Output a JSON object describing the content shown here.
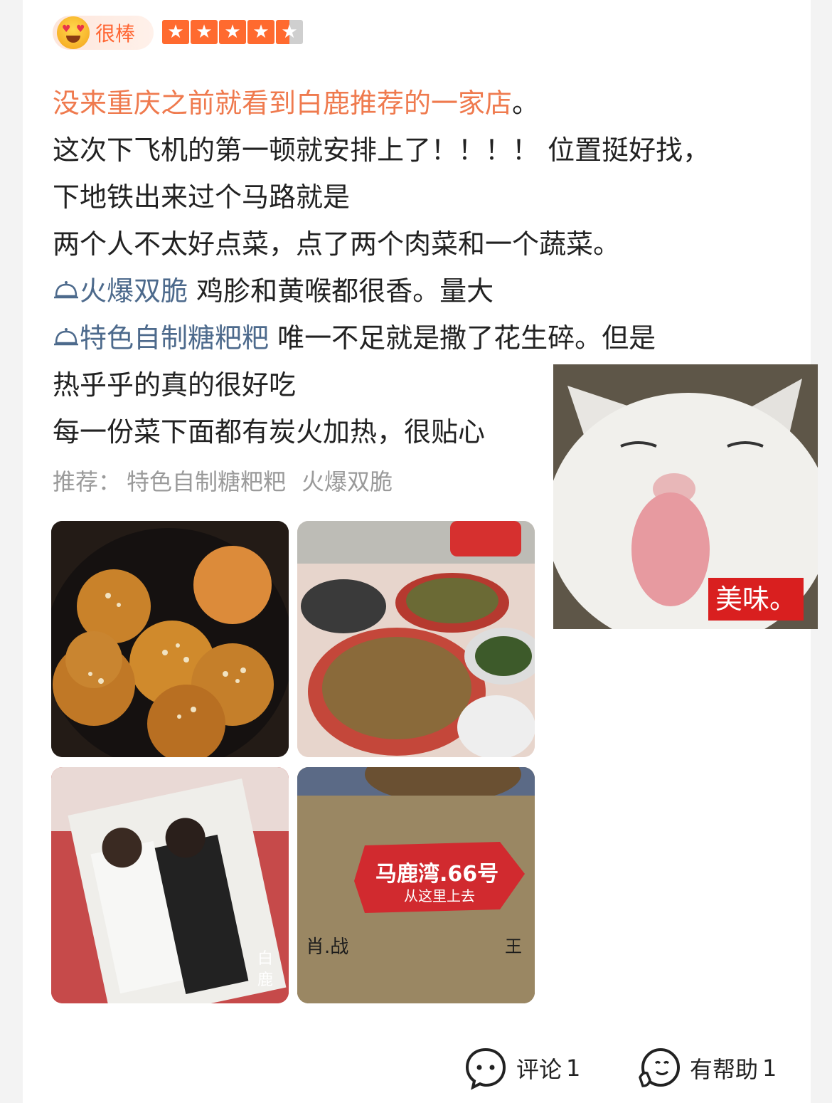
{
  "rating": {
    "badge_label": "很棒",
    "badge_icon": "heart-eyes-emoji-icon",
    "stars": 4.5,
    "star_color": "#ff6a2f"
  },
  "review": {
    "headline": "没来重庆之前就看到白鹿推荐的一家店",
    "headline_end": "。",
    "lines": [
      "这次下飞机的第一顿就安排上了！！！！ 位置挺好找，",
      "下地铁出来过个马路就是",
      "两个人不太好点菜，点了两个肉菜和一个蔬菜。"
    ],
    "dish_mentions": [
      {
        "name": "火爆双脆",
        "comment": " 鸡胗和黄喉都很香。量大"
      },
      {
        "name": "特色自制糖粑粑",
        "comment": " 唯一不足就是撒了花生碎。但是"
      }
    ],
    "closing_lines": [
      "热乎乎的真的很好吃",
      "每一份菜下面都有炭火加热，很贴心"
    ]
  },
  "recommend": {
    "label": "推荐：",
    "dishes": [
      "特色自制糖粑粑",
      "火爆双脆"
    ]
  },
  "photos": {
    "sign_text": "马鹿湾.66号",
    "sign_subtext": "从这里上去",
    "wall_names": [
      "肖.战",
      "王"
    ],
    "photo_card_text": "白鹿"
  },
  "meme": {
    "caption": "美味。"
  },
  "footer": {
    "comment_label": "评论",
    "comment_count": "1",
    "helpful_label": "有帮助",
    "helpful_count": "1"
  },
  "colors": {
    "headline": "#ef7a4e",
    "dish_tag": "#4d6a8c",
    "badge_text": "#ff6633"
  }
}
